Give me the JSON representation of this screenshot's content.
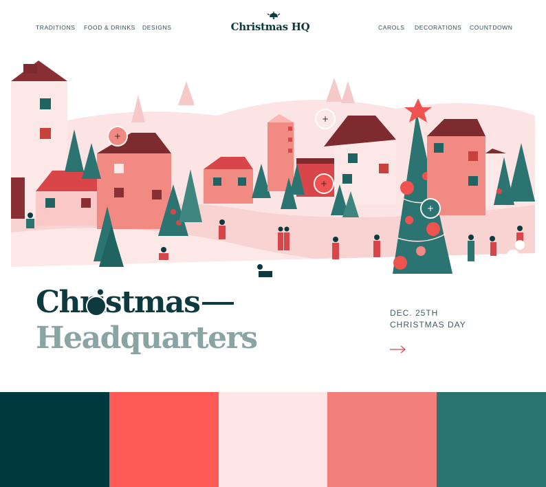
{
  "nav": {
    "left": [
      "TRADITIONS",
      "FOOD & DRINKS",
      "DESIGNS"
    ],
    "right": [
      "CAROLS",
      "DECORATIONS",
      "COUNTDOWN"
    ],
    "logo": "Christmas HQ"
  },
  "hero": {
    "hotspot_icon": "plus-icon"
  },
  "headline": {
    "line1": "Christmas",
    "line2": "Headquarters"
  },
  "event": {
    "date": "DEC. 25TH",
    "name": "CHRISTMAS DAY",
    "arrow_icon": "arrow-right-icon"
  },
  "palette": {
    "colors": [
      "#003a40",
      "#ff5a57",
      "#ffe6e6",
      "#f27f7b",
      "#2c7471"
    ]
  }
}
